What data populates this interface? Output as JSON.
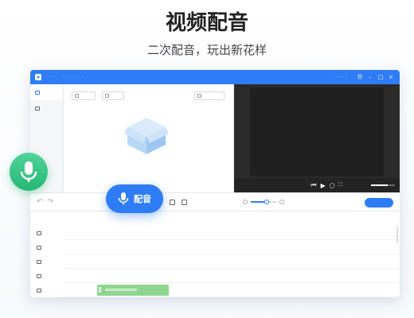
{
  "hero": {
    "title": "视频配音",
    "subtitle": "二次配音，玩出新花样"
  },
  "dub_button": {
    "label": "配音"
  },
  "colors": {
    "accent": "#2e7cf6",
    "float_mic_green": "#25b876",
    "audio_clip": "#8fd48f"
  },
  "icons": {
    "float_mic": "microphone-icon",
    "dub": "microphone-icon",
    "empty": "box-icon"
  },
  "audio_clip": {
    "waveform_level": 0.45
  }
}
